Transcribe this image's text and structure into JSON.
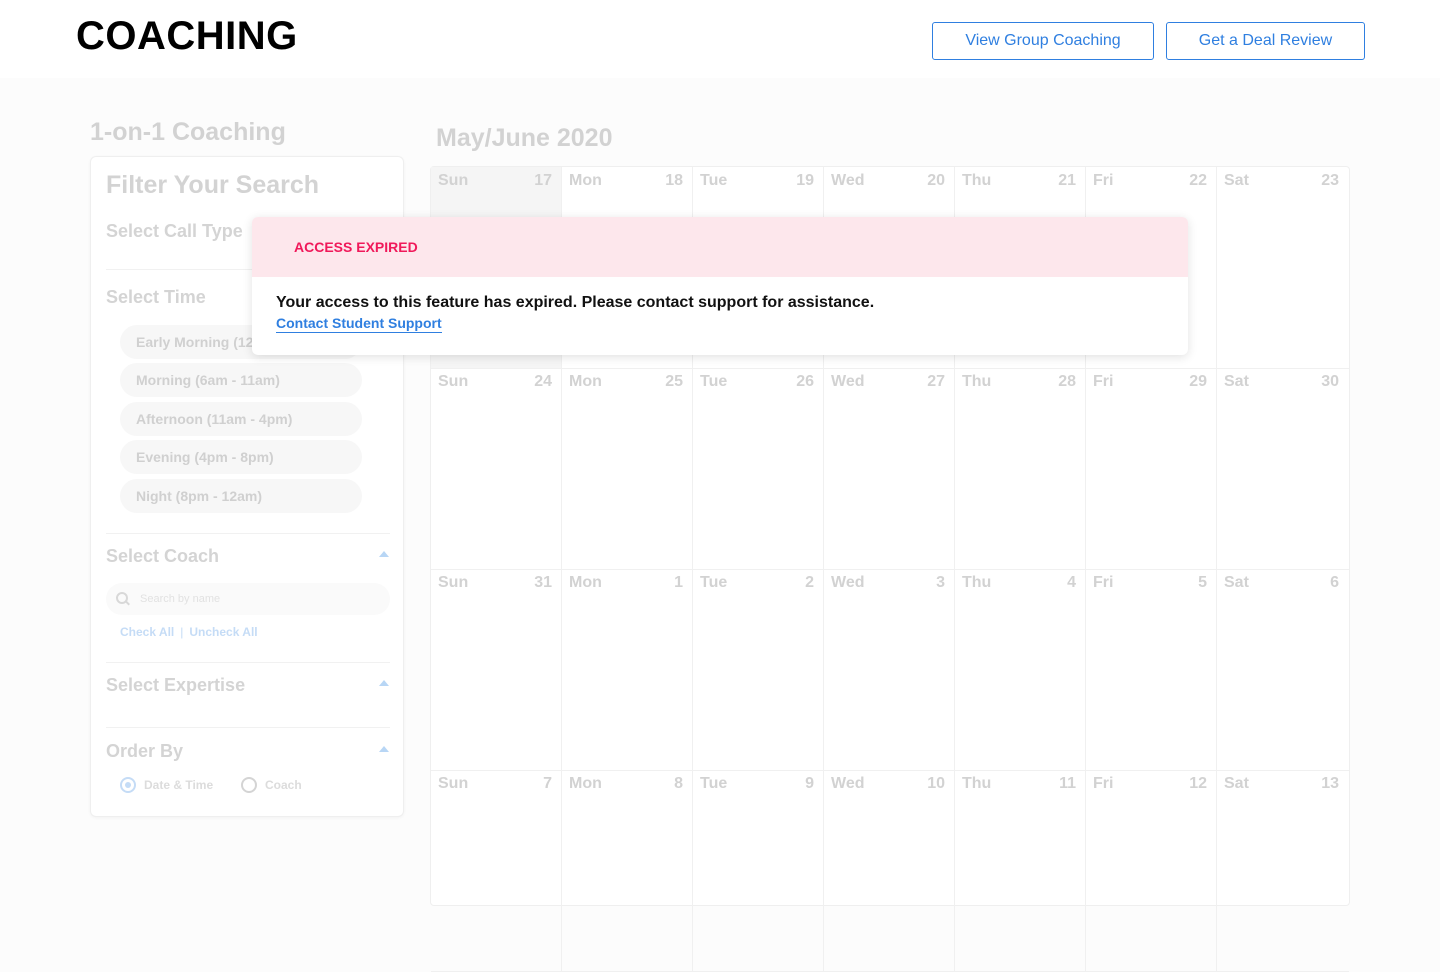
{
  "header": {
    "brand": "COACHING",
    "group_button": "View Group Coaching",
    "deal_button": "Get a Deal Review"
  },
  "section_title": "1-on-1 Coaching",
  "calendar_title": "May/June 2020",
  "filter": {
    "title": "Filter Your Search",
    "call_type_label": "Select Call Type",
    "time_label": "Select Time",
    "time_options": [
      "Early Morning (12am - 6am)",
      "Morning (6am - 11am)",
      "Afternoon (11am - 4pm)",
      "Evening (4pm - 8pm)",
      "Night (8pm - 12am)"
    ],
    "coach_label": "Select Coach",
    "search_placeholder": "Search by name",
    "check_all": "Check All",
    "uncheck_all": "Uncheck All",
    "separator": "|",
    "expertise_label": "Select Expertise",
    "order_label": "Order By",
    "order_options": [
      "Date & Time",
      "Coach"
    ],
    "order_selected": "Date & Time"
  },
  "calendar": {
    "day_names": [
      "Sun",
      "Mon",
      "Tue",
      "Wed",
      "Thu",
      "Fri",
      "Sat"
    ],
    "weeks": [
      [
        "17",
        "18",
        "19",
        "20",
        "21",
        "22",
        "23"
      ],
      [
        "24",
        "25",
        "26",
        "27",
        "28",
        "29",
        "30"
      ],
      [
        "31",
        "1",
        "2",
        "3",
        "4",
        "5",
        "6"
      ],
      [
        "7",
        "8",
        "9",
        "10",
        "11",
        "12",
        "13"
      ]
    ],
    "today": "17"
  },
  "modal": {
    "title": "ACCESS EXPIRED",
    "message": "Your access to this feature has expired. Please contact support for assistance.",
    "link": "Contact Student Support"
  },
  "colors": {
    "accent": "#2f7fe0",
    "alert_text": "#f0195a",
    "alert_bg": "#fde7ec"
  }
}
